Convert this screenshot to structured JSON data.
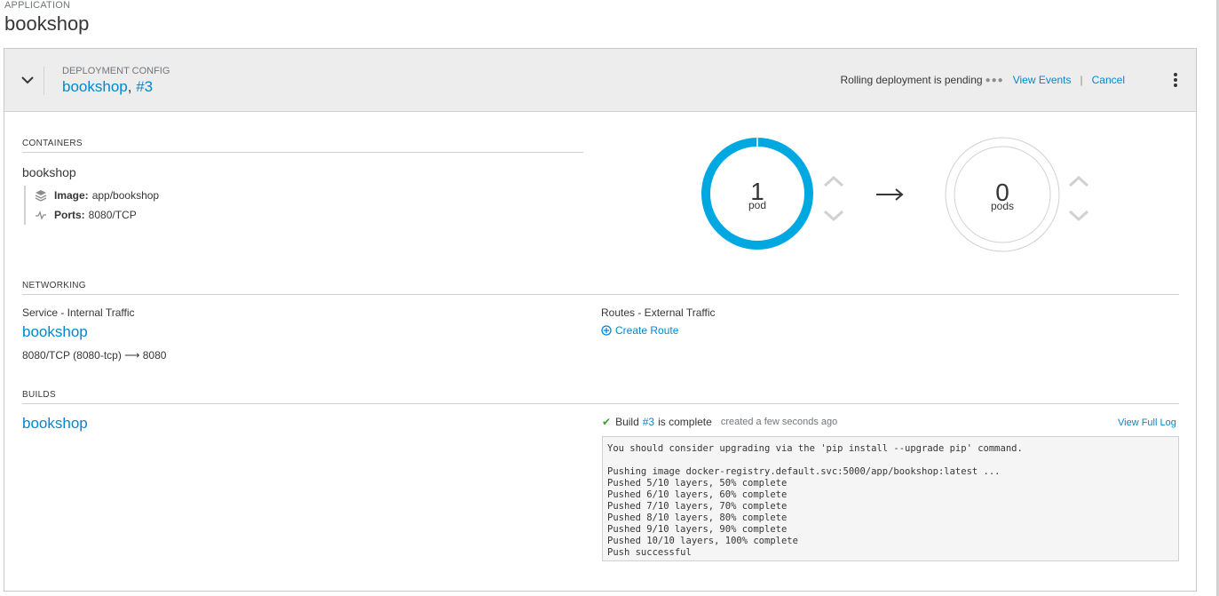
{
  "application": {
    "label": "APPLICATION",
    "name": "bookshop"
  },
  "deployment": {
    "label": "DEPLOYMENT CONFIG",
    "name": "bookshop",
    "separator": ", ",
    "version": "#3",
    "status_text": "Rolling deployment is pending",
    "view_events": "View Events",
    "cancel": "Cancel"
  },
  "containers": {
    "section_label": "CONTAINERS",
    "name": "bookshop",
    "image_label": "Image:",
    "image_value": "app/bookshop",
    "ports_label": "Ports:",
    "ports_value": "8080/TCP"
  },
  "pods": {
    "current": {
      "count": "1",
      "unit": "pod",
      "color": "#00a8e1"
    },
    "target": {
      "count": "0",
      "unit": "pods",
      "color": "#d1d1d1"
    }
  },
  "networking": {
    "section_label": "NETWORKING",
    "service_label": "Service - Internal Traffic",
    "service_name": "bookshop",
    "service_port": "8080/TCP (8080-tcp)",
    "service_target": "8080",
    "routes_label": "Routes - External Traffic",
    "create_route": "Create Route"
  },
  "builds": {
    "section_label": "BUILDS",
    "name": "bookshop",
    "status_prefix": "Build",
    "build_number": "#3",
    "status_suffix": "is complete",
    "timestamp": "created a few seconds ago",
    "view_full_log": "View Full Log",
    "log_lines": [
      "You should consider upgrading via the 'pip install --upgrade pip' command.",
      "",
      "Pushing image docker-registry.default.svc:5000/app/bookshop:latest ...",
      "Pushed 5/10 layers, 50% complete",
      "Pushed 6/10 layers, 60% complete",
      "Pushed 7/10 layers, 70% complete",
      "Pushed 8/10 layers, 80% complete",
      "Pushed 9/10 layers, 90% complete",
      "Pushed 10/10 layers, 100% complete",
      "Push successful"
    ]
  },
  "colors": {
    "link": "#0088ce",
    "success": "#3f9c35",
    "donut": "#00a8e1"
  }
}
